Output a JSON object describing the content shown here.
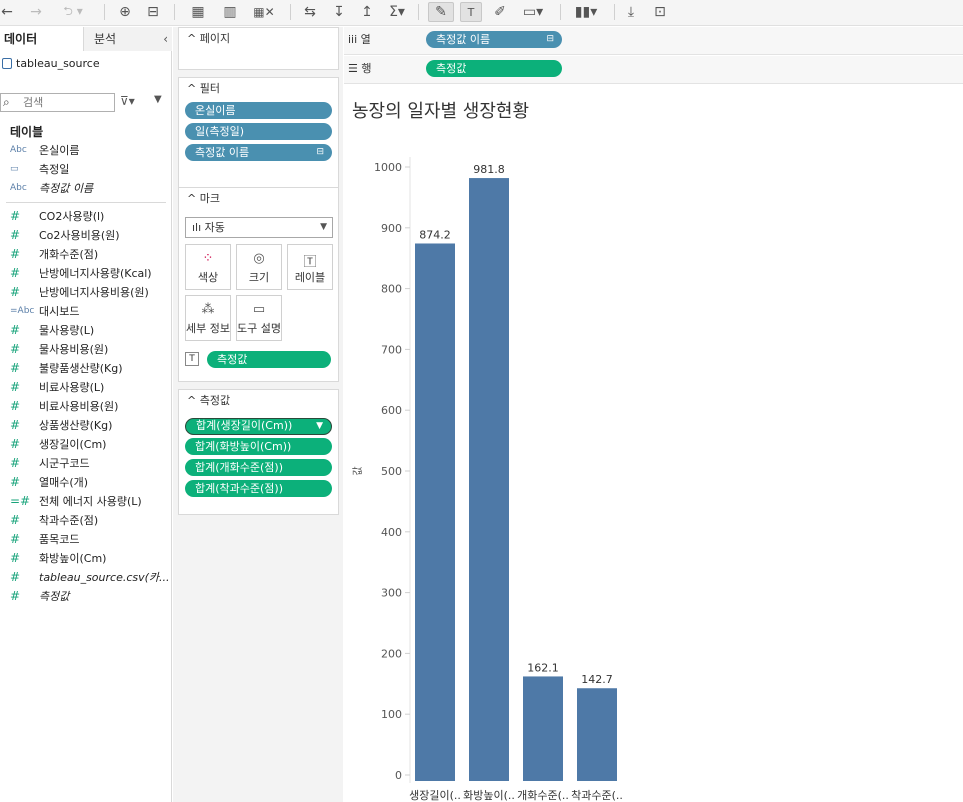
{
  "data_pane": {
    "tab_data": "데이터",
    "tab_analysis": "분석",
    "collapse_glyph": "‹",
    "datasource": "tableau_source",
    "search_placeholder": "검색",
    "table_header": "테이블",
    "dimensions": [
      {
        "icon": "Abc",
        "label": "온실이름",
        "italic": false
      },
      {
        "icon": "cal",
        "label": "측정일",
        "italic": false
      },
      {
        "icon": "Abc",
        "label": "측정값 이름",
        "italic": true
      }
    ],
    "measures": [
      {
        "icon": "#",
        "label": "CO2사용량(l)",
        "italic": false
      },
      {
        "icon": "#",
        "label": "Co2사용비용(원)",
        "italic": false
      },
      {
        "icon": "#",
        "label": "개화수준(점)",
        "italic": false
      },
      {
        "icon": "#",
        "label": "난방에너지사용량(Kcal)",
        "italic": false
      },
      {
        "icon": "#",
        "label": "난방에너지사용비용(원)",
        "italic": false
      },
      {
        "icon": "=Abc",
        "label": "대시보드",
        "italic": false
      },
      {
        "icon": "#",
        "label": "물사용량(L)",
        "italic": false
      },
      {
        "icon": "#",
        "label": "물사용비용(원)",
        "italic": false
      },
      {
        "icon": "#",
        "label": "불량품생산량(Kg)",
        "italic": false
      },
      {
        "icon": "#",
        "label": "비료사용량(L)",
        "italic": false
      },
      {
        "icon": "#",
        "label": "비료사용비용(원)",
        "italic": false
      },
      {
        "icon": "#",
        "label": "상품생산량(Kg)",
        "italic": false
      },
      {
        "icon": "#",
        "label": "생장길이(Cm)",
        "italic": false
      },
      {
        "icon": "#",
        "label": "시군구코드",
        "italic": false
      },
      {
        "icon": "#",
        "label": "열매수(개)",
        "italic": false
      },
      {
        "icon": "=#",
        "label": "전체 에너지 사용량(L)",
        "italic": false
      },
      {
        "icon": "#",
        "label": "착과수준(점)",
        "italic": false
      },
      {
        "icon": "#",
        "label": "품목코드",
        "italic": false
      },
      {
        "icon": "#",
        "label": "화방높이(Cm)",
        "italic": false
      },
      {
        "icon": "#",
        "label": "tableau_source.csv(카...",
        "italic": true
      },
      {
        "icon": "#",
        "label": "측정값",
        "italic": true
      }
    ]
  },
  "pages_card": {
    "title": "페이지"
  },
  "filters_card": {
    "title": "필터",
    "pills": [
      "온실이름",
      "일(측정일)",
      "측정값 이름"
    ]
  },
  "marks_card": {
    "title": "마크",
    "mark_type": "자동",
    "buttons": [
      {
        "name": "color",
        "label": "색상"
      },
      {
        "name": "size",
        "label": "크기"
      },
      {
        "name": "label",
        "label": "레이블"
      },
      {
        "name": "detail",
        "label": "세부 정보"
      },
      {
        "name": "tooltip",
        "label": "도구 설명"
      }
    ],
    "label_pill": "측정값"
  },
  "measure_values_card": {
    "title": "측정값",
    "pills": [
      "합계(생장길이(Cm))",
      "합계(화방높이(Cm))",
      "합계(개화수준(점))",
      "합계(착과수준(점))"
    ]
  },
  "columns_shelf": {
    "label": "열",
    "pill": "측정값 이름"
  },
  "rows_shelf": {
    "label": "행",
    "pill": "측정값"
  },
  "sheet_title": "농장의 일자별 생장현황",
  "colors": {
    "bar": "#4e79a7",
    "dim_pill": "#4a90b0",
    "measure_pill": "#0cb07a"
  },
  "chart_data": {
    "type": "bar",
    "categories": [
      "생장길이(..",
      "화방높이(..",
      "개화수준(..",
      "착과수준(.."
    ],
    "values": [
      874.2,
      981.8,
      162.1,
      142.7
    ],
    "value_labels": [
      "874.2",
      "981.8",
      "162.1",
      "142.7"
    ],
    "ylabel": "값",
    "ylim": [
      0,
      1000
    ],
    "yticks": [
      0,
      100,
      200,
      300,
      400,
      500,
      600,
      700,
      800,
      900,
      1000
    ]
  }
}
